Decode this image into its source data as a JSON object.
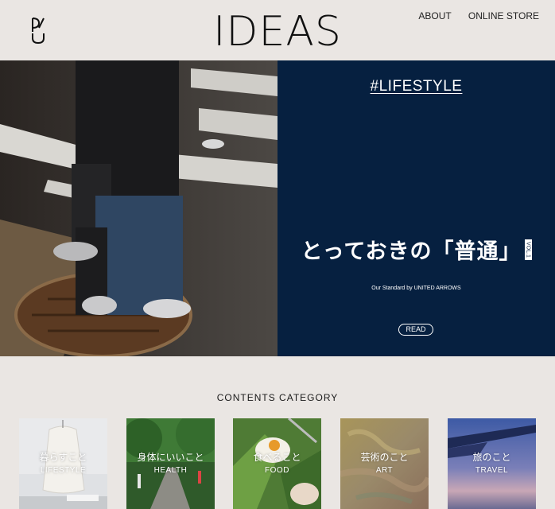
{
  "header": {
    "title": "IDEAS",
    "nav": [
      "ABOUT",
      "ONLINE STORE"
    ]
  },
  "hero": {
    "tag": "#LIFESTYLE",
    "headline": "とっておきの「普通」",
    "volume": "VOL.1",
    "subtitle": "Our Standard by UNITED ARROWS",
    "read_label": "READ",
    "panel_color": "#062040"
  },
  "contents": {
    "title": "CONTENTS CATEGORY",
    "categories": [
      {
        "jp": "暮らすこと",
        "en": "LIFESTYLE"
      },
      {
        "jp": "身体にいいこと",
        "en": "HEALTH"
      },
      {
        "jp": "食べること",
        "en": "FOOD"
      },
      {
        "jp": "芸術のこと",
        "en": "ART"
      },
      {
        "jp": "旅のこと",
        "en": "TRAVEL"
      }
    ]
  }
}
